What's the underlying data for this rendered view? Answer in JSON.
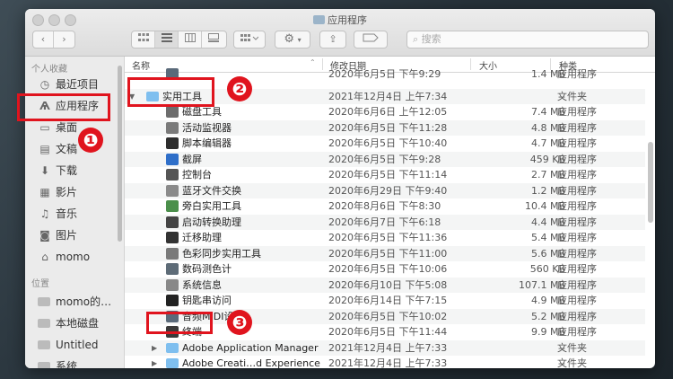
{
  "window": {
    "title": "应用程序",
    "search_placeholder": "搜索"
  },
  "sidebar": {
    "favorites_title": "个人收藏",
    "favorites": [
      {
        "label": "最近项目",
        "icon": "clock-icon"
      },
      {
        "label": "应用程序",
        "icon": "apps-icon",
        "selected": true
      },
      {
        "label": "桌面",
        "icon": "desktop-icon"
      },
      {
        "label": "文稿",
        "icon": "document-icon"
      },
      {
        "label": "下载",
        "icon": "download-icon"
      },
      {
        "label": "影片",
        "icon": "film-icon"
      },
      {
        "label": "音乐",
        "icon": "music-icon"
      },
      {
        "label": "图片",
        "icon": "camera-icon"
      },
      {
        "label": "momo",
        "icon": "home-icon"
      }
    ],
    "locations_title": "位置",
    "locations": [
      {
        "label": "momo的…",
        "icon": "computer-icon"
      },
      {
        "label": "本地磁盘",
        "icon": "disk-icon"
      },
      {
        "label": "Untitled",
        "icon": "disk-icon"
      },
      {
        "label": "系统",
        "icon": "disk-icon"
      }
    ]
  },
  "columns": {
    "name": "名称",
    "date": "修改日期",
    "size": "大小",
    "kind": "种类"
  },
  "rows": [
    {
      "name": "",
      "date": "2020年6月5日 下午9:29",
      "size": "1.4 MB",
      "kind": "应用程序",
      "indent": 2,
      "partial": true
    },
    {
      "name": "实用工具",
      "date": "2021年12月4日 上午7:34",
      "size": "--",
      "kind": "文件夹",
      "indent": 0,
      "folder": true,
      "expanded": true
    },
    {
      "name": "磁盘工具",
      "date": "2020年6月6日 上午12:05",
      "size": "7.4 MB",
      "kind": "应用程序",
      "indent": 2
    },
    {
      "name": "活动监视器",
      "date": "2020年6月5日 下午11:28",
      "size": "4.8 MB",
      "kind": "应用程序",
      "indent": 2
    },
    {
      "name": "脚本编辑器",
      "date": "2020年6月5日 下午10:40",
      "size": "4.7 MB",
      "kind": "应用程序",
      "indent": 2
    },
    {
      "name": "截屏",
      "date": "2020年6月5日 下午9:28",
      "size": "459 KB",
      "kind": "应用程序",
      "indent": 2
    },
    {
      "name": "控制台",
      "date": "2020年6月5日 下午11:14",
      "size": "2.7 MB",
      "kind": "应用程序",
      "indent": 2
    },
    {
      "name": "蓝牙文件交换",
      "date": "2020年6月29日 下午9:40",
      "size": "1.2 MB",
      "kind": "应用程序",
      "indent": 2
    },
    {
      "name": "旁白实用工具",
      "date": "2020年8月6日 下午8:30",
      "size": "10.4 MB",
      "kind": "应用程序",
      "indent": 2
    },
    {
      "name": "启动转换助理",
      "date": "2020年6月7日 下午6:18",
      "size": "4.4 MB",
      "kind": "应用程序",
      "indent": 2
    },
    {
      "name": "迁移助理",
      "date": "2020年6月5日 下午11:36",
      "size": "5.4 MB",
      "kind": "应用程序",
      "indent": 2
    },
    {
      "name": "色彩同步实用工具",
      "date": "2020年6月5日 下午11:00",
      "size": "5.6 MB",
      "kind": "应用程序",
      "indent": 2
    },
    {
      "name": "数码测色计",
      "date": "2020年6月5日 下午10:06",
      "size": "560 KB",
      "kind": "应用程序",
      "indent": 2
    },
    {
      "name": "系统信息",
      "date": "2020年6月10日 下午5:08",
      "size": "107.1 MB",
      "kind": "应用程序",
      "indent": 2
    },
    {
      "name": "钥匙串访问",
      "date": "2020年6月14日 下午7:15",
      "size": "4.9 MB",
      "kind": "应用程序",
      "indent": 2
    },
    {
      "name": "音频MIDI设置",
      "date": "2020年6月5日 下午10:02",
      "size": "5.2 MB",
      "kind": "应用程序",
      "indent": 2
    },
    {
      "name": "终端",
      "date": "2020年6月5日 下午11:44",
      "size": "9.9 MB",
      "kind": "应用程序",
      "indent": 2
    },
    {
      "name": "Adobe Application Manager",
      "date": "2021年12月4日 上午7:33",
      "size": "--",
      "kind": "文件夹",
      "indent": 1,
      "folder": true
    },
    {
      "name": "Adobe Creati…d Experience",
      "date": "2021年12月4日 上午7:33",
      "size": "--",
      "kind": "文件夹",
      "indent": 1,
      "folder": true
    }
  ],
  "annotations": [
    "❶",
    "❷",
    "❸"
  ],
  "toolbar": {
    "back": "‹",
    "forward": "›",
    "gear": "⚙",
    "share": "⇪"
  },
  "colors": {
    "highlight": "#e0141e",
    "folder": "#7fbfef"
  }
}
